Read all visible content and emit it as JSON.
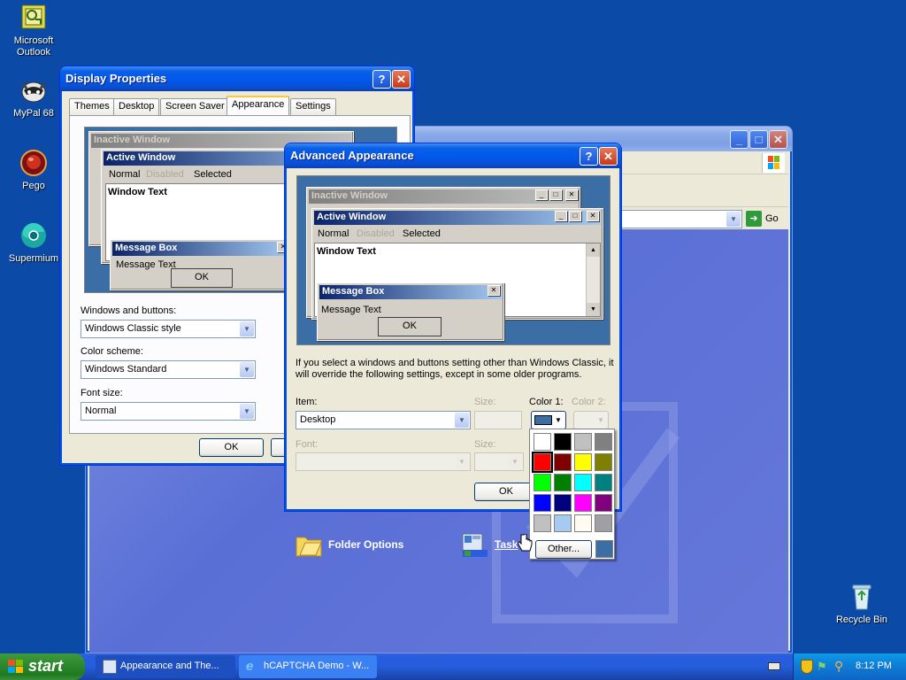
{
  "desktop_icons": [
    {
      "label": "Microsoft Outlook",
      "icon": "outlook-icon"
    },
    {
      "label": "MyPal 68",
      "icon": "mypal-raccoon-icon"
    },
    {
      "label": "Pego",
      "icon": "pego-icon"
    },
    {
      "label": "Supermium",
      "icon": "supermium-icon"
    },
    {
      "label": "Recycle Bin",
      "icon": "recycle-bin-icon"
    }
  ],
  "background_window": {
    "go_label": "Go",
    "items": [
      {
        "label": "Folder Options",
        "icon": "folder-options-icon"
      },
      {
        "label": "Task",
        "icon": "taskbar-start-menu-icon"
      }
    ]
  },
  "display_properties": {
    "title": "Display Properties",
    "help": "?",
    "close": "X",
    "tabs": [
      "Themes",
      "Desktop",
      "Screen Saver",
      "Appearance",
      "Settings"
    ],
    "active_tab": "Appearance",
    "preview": {
      "inactive_title": "Inactive Window",
      "active_title": "Active Window",
      "menu": [
        "Normal",
        "Disabled",
        "Selected"
      ],
      "window_text": "Window Text",
      "message_box_title": "Message Box",
      "message_text": "Message Text",
      "ok": "OK"
    },
    "windows_buttons_label": "Windows and buttons:",
    "windows_buttons_value": "Windows Classic style",
    "color_scheme_label": "Color scheme:",
    "color_scheme_value": "Windows Standard",
    "font_size_label": "Font size:",
    "font_size_value": "Normal",
    "ok": "OK"
  },
  "advanced_appearance": {
    "title": "Advanced Appearance",
    "help": "?",
    "close": "X",
    "preview": {
      "inactive_title": "Inactive Window",
      "active_title": "Active Window",
      "menu": [
        "Normal",
        "Disabled",
        "Selected"
      ],
      "window_text": "Window Text",
      "message_box_title": "Message Box",
      "message_text": "Message Text",
      "ok": "OK"
    },
    "note": "If you select a windows and buttons setting other than Windows Classic, it will override the following settings, except in some older programs.",
    "item_label": "Item:",
    "item_value": "Desktop",
    "size_label": "Size:",
    "color1_label": "Color 1:",
    "color2_label": "Color 2:",
    "font_label": "Font:",
    "size2_label": "Size:",
    "ok": "OK",
    "current_color": "#3a6ea5"
  },
  "color_palette": {
    "colors": [
      "#ffffff",
      "#000000",
      "#c0c0c0",
      "#808080",
      "#ff0000",
      "#800000",
      "#ffff00",
      "#808000",
      "#00ff00",
      "#008000",
      "#00ffff",
      "#008080",
      "#0000ff",
      "#000080",
      "#ff00ff",
      "#800080",
      "#c0c0c0",
      "#a6caf0",
      "#fffbf0",
      "#a0a0a4"
    ],
    "selected_index": 4,
    "other_label": "Other...",
    "custom_color": "#3a6ea5"
  },
  "taskbar": {
    "start_label": "start",
    "tasks": [
      {
        "label": "Appearance and The...",
        "icon": "control-panel-icon"
      },
      {
        "label": "hCAPTCHA Demo - W...",
        "icon": "internet-explorer-icon"
      }
    ],
    "clock": "8:12 PM"
  },
  "colors": {
    "desktop": "#0b4aa6",
    "xp_title_blue": "#0058ee",
    "dialog_face": "#ece9d8"
  }
}
